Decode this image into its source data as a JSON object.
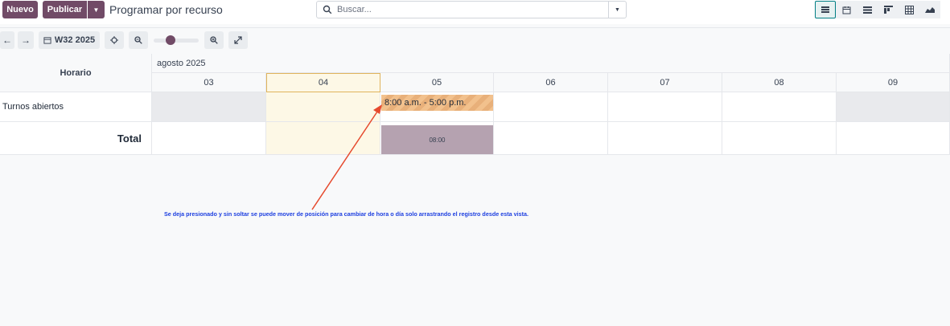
{
  "header": {
    "new_label": "Nuevo",
    "publish_label": "Publicar",
    "page_title": "Programar por recurso",
    "search_placeholder": "Buscar...",
    "views": [
      "gantt-icon",
      "calendar-icon",
      "list-icon",
      "kanban-icon",
      "pivot-icon",
      "graph-icon"
    ],
    "active_view": "gantt-icon"
  },
  "toolbar": {
    "prev_icon": "arrow-left-icon",
    "next_icon": "arrow-right-icon",
    "week_label": "W32 2025",
    "zoom_level": 0.5
  },
  "gantt": {
    "row_header_title": "Horario",
    "month_label": "agosto 2025",
    "days": [
      "03",
      "04",
      "05",
      "06",
      "07",
      "08",
      "09"
    ],
    "today": "04",
    "rows": [
      {
        "label": "Turnos abiertos"
      }
    ],
    "total_label": "Total",
    "shift_label": "8:00 a.m. - 5:00 p.m.",
    "total_value": "08:00"
  },
  "annotation": {
    "text": "Se deja presionado y sin soltar se puede mover de posición para cambiar de hora o día solo arrastrando el registro desde esta vista.",
    "color": "#1d3fe0",
    "arrow_color": "#e64a2e"
  },
  "colors": {
    "brand": "#714b67",
    "accent": "#017e84",
    "shift": "#f2c18d",
    "total": "#b5a2b0"
  }
}
